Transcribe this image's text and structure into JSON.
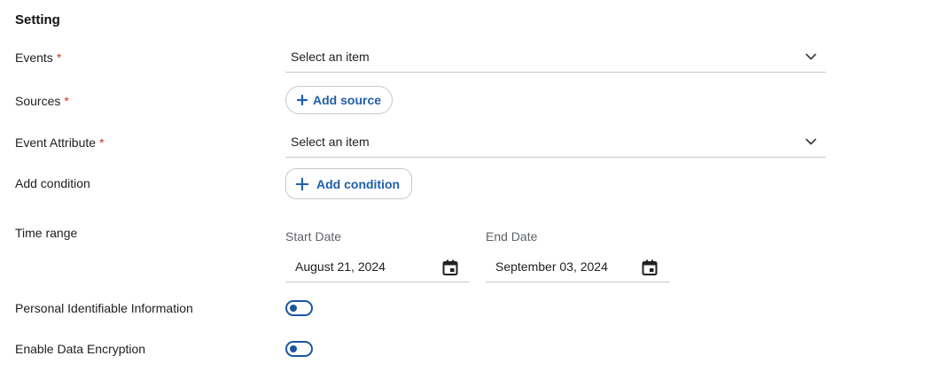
{
  "section": {
    "title": "Setting"
  },
  "events": {
    "label": "Events",
    "required_mark": "*",
    "value": "Select an item"
  },
  "sources": {
    "label": "Sources",
    "required_mark": "*",
    "button_label": "Add source"
  },
  "event_attribute": {
    "label": "Event Attribute",
    "required_mark": "*",
    "value": "Select an item"
  },
  "add_condition": {
    "label": "Add condition",
    "button_label": "Add condition"
  },
  "time_range": {
    "label": "Time range",
    "start_caption": "Start Date",
    "start_value": "August 21, 2024",
    "end_caption": "End Date",
    "end_value": "September 03, 2024"
  },
  "pii": {
    "label": "Personal Identifiable Information",
    "enabled": false
  },
  "encryption": {
    "label": "Enable Data Encryption",
    "enabled": false
  },
  "colors": {
    "accent": "#1f5fa8",
    "required": "#d93025",
    "divider": "#c6c9cc"
  },
  "icons": {
    "dropdown": "chevron-down-icon",
    "add": "plus-icon",
    "date": "calendar-icon"
  }
}
